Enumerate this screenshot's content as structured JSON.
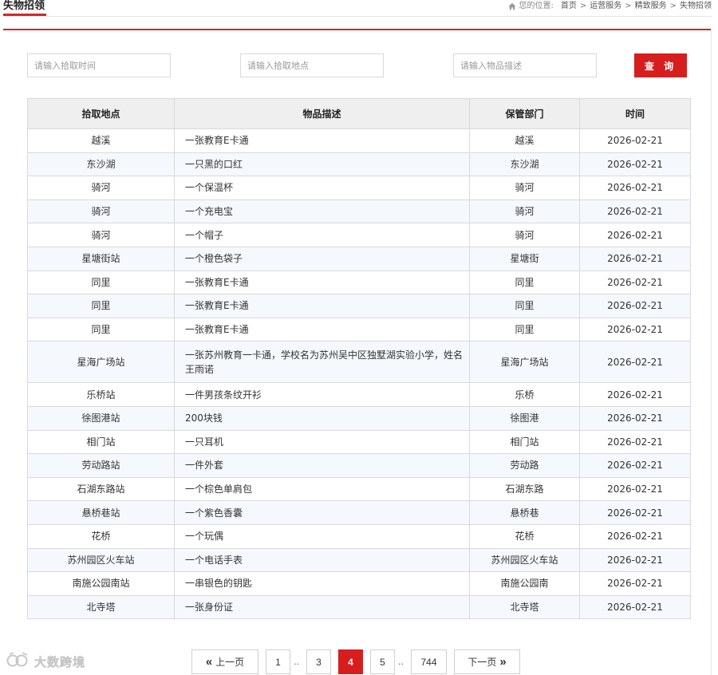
{
  "header": {
    "title": "失物招领",
    "breadcrumb_label": "您的位置:",
    "breadcrumb": [
      "首页",
      "运营服务",
      "精致服务",
      "失物招领"
    ],
    "breadcrumb_sep": ">"
  },
  "search": {
    "time_placeholder": "请输入拾取时间",
    "location_placeholder": "请输入拾取地点",
    "desc_placeholder": "请输入物品描述",
    "button_label": "查 询"
  },
  "table": {
    "columns": [
      "拾取地点",
      "物品描述",
      "保管部门",
      "时间"
    ],
    "rows": [
      {
        "location": "越溪",
        "description": "一张教育E卡通",
        "department": "越溪",
        "date": "2026-02-21"
      },
      {
        "location": "东沙湖",
        "description": "一只黑的口红",
        "department": "东沙湖",
        "date": "2026-02-21"
      },
      {
        "location": "骑河",
        "description": "一个保温杯",
        "department": "骑河",
        "date": "2026-02-21"
      },
      {
        "location": "骑河",
        "description": "一个充电宝",
        "department": "骑河",
        "date": "2026-02-21"
      },
      {
        "location": "骑河",
        "description": "一个帽子",
        "department": "骑河",
        "date": "2026-02-21"
      },
      {
        "location": "星塘街站",
        "description": "一个橙色袋子",
        "department": "星塘街",
        "date": "2026-02-21"
      },
      {
        "location": "同里",
        "description": "一张教育E卡通",
        "department": "同里",
        "date": "2026-02-21"
      },
      {
        "location": "同里",
        "description": "一张教育E卡通",
        "department": "同里",
        "date": "2026-02-21"
      },
      {
        "location": "同里",
        "description": "一张教育E卡通",
        "department": "同里",
        "date": "2026-02-21"
      },
      {
        "location": "星海广场站",
        "description": "一张苏州教育一卡通，学校名为苏州吴中区独墅湖实验小学，姓名王雨诺",
        "department": "星海广场站",
        "date": "2026-02-21"
      },
      {
        "location": "乐桥站",
        "description": "一件男孩条纹开衫",
        "department": "乐桥",
        "date": "2026-02-21"
      },
      {
        "location": "徐图港站",
        "description": "200块钱",
        "department": "徐图港",
        "date": "2026-02-21"
      },
      {
        "location": "相门站",
        "description": "一只耳机",
        "department": "相门站",
        "date": "2026-02-21"
      },
      {
        "location": "劳动路站",
        "description": "一件外套",
        "department": "劳动路",
        "date": "2026-02-21"
      },
      {
        "location": "石湖东路站",
        "description": "一个棕色单肩包",
        "department": "石湖东路",
        "date": "2026-02-21"
      },
      {
        "location": "悬桥巷站",
        "description": "一个紫色香囊",
        "department": "悬桥巷",
        "date": "2026-02-21"
      },
      {
        "location": "花桥",
        "description": "一个玩偶",
        "department": "花桥",
        "date": "2026-02-21"
      },
      {
        "location": "苏州园区火车站",
        "description": "一个电话手表",
        "department": "苏州园区火车站",
        "date": "2026-02-21"
      },
      {
        "location": "南施公园南站",
        "description": "一串银色的钥匙",
        "department": "南施公园南",
        "date": "2026-02-21"
      },
      {
        "location": "北寺塔",
        "description": "一张身份证",
        "department": "北寺塔",
        "date": "2026-02-21"
      }
    ]
  },
  "pagination": {
    "prev_label": "上一页",
    "next_label": "下一页",
    "prev_glyph": "«",
    "next_glyph": "»",
    "ellipsis": "..",
    "pages": [
      "1",
      "3",
      "4",
      "5",
      "744"
    ],
    "current": "4"
  },
  "watermark": {
    "text": "大数跨境"
  },
  "colors": {
    "accent": "#d61e1e",
    "header_bg": "#efefef",
    "stripe": "#f5f8fd",
    "border": "#d9d9d9"
  },
  "icons": {
    "breadcrumb": "home-icon",
    "watermark": "watermark-logo-icon"
  }
}
